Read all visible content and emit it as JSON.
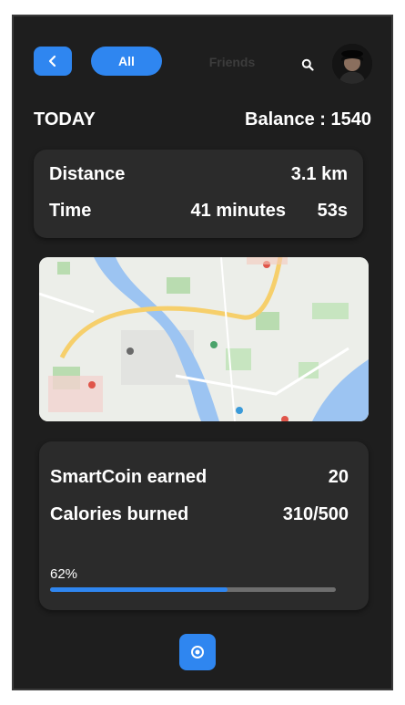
{
  "colors": {
    "accent": "#2f86f0",
    "background": "#1e1e1e",
    "card": "#2b2b2b",
    "text": "#ffffff",
    "muted": "#3c3c3c"
  },
  "header": {
    "back_icon": "chevron-left-icon",
    "filter_all": "All",
    "filter_friends": "Friends",
    "search_icon": "search-icon",
    "avatar_icon": "avatar"
  },
  "summary": {
    "day_label": "TODAY",
    "balance_label": "Balance : 1540"
  },
  "activity": {
    "distance_label": "Distance",
    "distance_value": "3.1 km",
    "time_label": "Time",
    "time_minutes": "41 minutes",
    "time_seconds": "53s"
  },
  "rewards": {
    "coins_label": "SmartCoin earned",
    "coins_value": "20",
    "calories_label": "Calories burned",
    "calories_value": "310/500",
    "progress_label": "62%",
    "progress_fraction": 0.62
  },
  "footer": {
    "action_icon": "record-icon"
  }
}
